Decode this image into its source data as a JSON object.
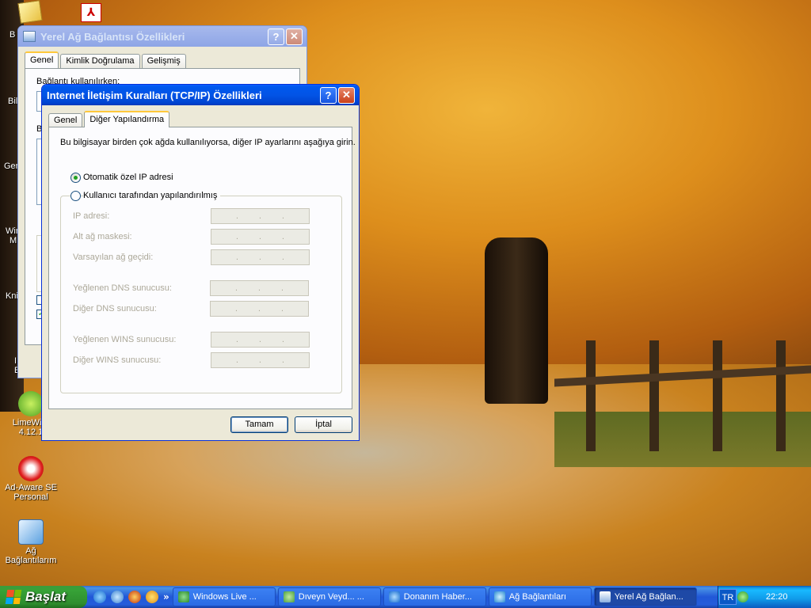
{
  "desktop": {
    "icons": [
      {
        "label": "LimeWire 4.12.1",
        "icon": "limewire-icon"
      },
      {
        "label": "Ad-Aware SE Personal",
        "icon": "adaware-icon"
      },
      {
        "label": "Ağ Bağlantılarım",
        "icon": "network-connections-icon"
      }
    ],
    "edge_labels": [
      "B",
      "Bil",
      "Gen",
      "Win",
      "M",
      "Kni",
      "I",
      "E"
    ]
  },
  "back_window": {
    "title": "Yerel Ağ Bağlantısı Özellikleri",
    "tabs": [
      "Genel",
      "Kimlik Doğrulama",
      "Gelişmiş"
    ],
    "selected_tab": "Genel",
    "partial_label": "Bağlantı kullanılırken:"
  },
  "dialog": {
    "title": "Internet İletişim Kuralları (TCP/IP) Özellikleri",
    "tabs": [
      "Genel",
      "Diğer Yapılandırma"
    ],
    "selected_tab": "Diğer Yapılandırma",
    "description": "Bu bilgisayar birden çok ağda kullanılıyorsa, diğer IP ayarlarını aşağıya girin.",
    "radio_auto": "Otomatik özel IP adresi",
    "radio_user": "Kullanıcı tarafından yapılandırılmış",
    "selected_option": "radio_auto",
    "fields": [
      {
        "label": "IP adresi:"
      },
      {
        "label": "Alt ağ maskesi:"
      },
      {
        "label": "Varsayılan ağ geçidi:"
      },
      {
        "label": "Yeğlenen DNS sunucusu:"
      },
      {
        "label": "Diğer DNS sunucusu:"
      },
      {
        "label": "Yeğlenen WINS sunucusu:"
      },
      {
        "label": "Diğer WINS sunucusu:"
      }
    ],
    "ok_button": "Tamam",
    "cancel_button": "İptal"
  },
  "taskbar": {
    "start_label": "Başlat",
    "items": [
      {
        "label": "Windows Live ...",
        "icon": "messenger-icon",
        "active": false
      },
      {
        "label": "Dıveyn Veyd... ...",
        "icon": "messenger-chat-icon",
        "active": false
      },
      {
        "label": "Donanım Haber...",
        "icon": "ie-icon",
        "active": false
      },
      {
        "label": "Ağ Bağlantıları",
        "icon": "network-icon",
        "active": false
      },
      {
        "label": "Yerel Ağ Bağlan...",
        "icon": "lan-icon",
        "active": true
      }
    ],
    "language": "TR",
    "clock": "22:20"
  }
}
